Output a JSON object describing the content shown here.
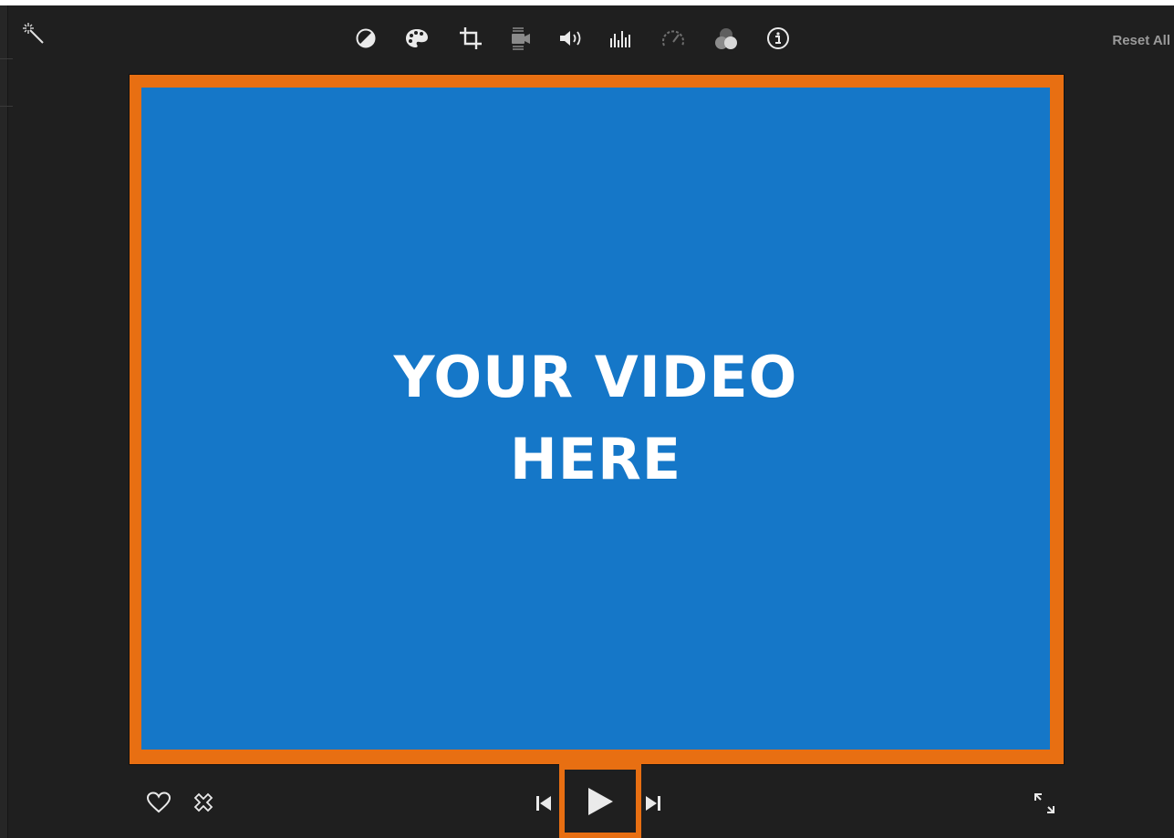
{
  "toolbar": {
    "reset_all_label": "Reset All",
    "icons": [
      "magic-wand-icon",
      "color-balance-icon",
      "color-palette-icon",
      "crop-icon",
      "stabilization-icon",
      "volume-icon",
      "equalizer-icon",
      "speed-icon",
      "clip-filter-icon",
      "info-icon"
    ]
  },
  "viewer": {
    "line1": "YOUR VIDEO",
    "line2": "HERE",
    "frame_color": "#e86f12",
    "video_color": "#1577c8"
  },
  "controls": {
    "icons": [
      "favorite-heart-icon",
      "reject-x-icon",
      "skip-back-icon",
      "play-icon",
      "skip-forward-icon",
      "fullscreen-icon"
    ]
  }
}
